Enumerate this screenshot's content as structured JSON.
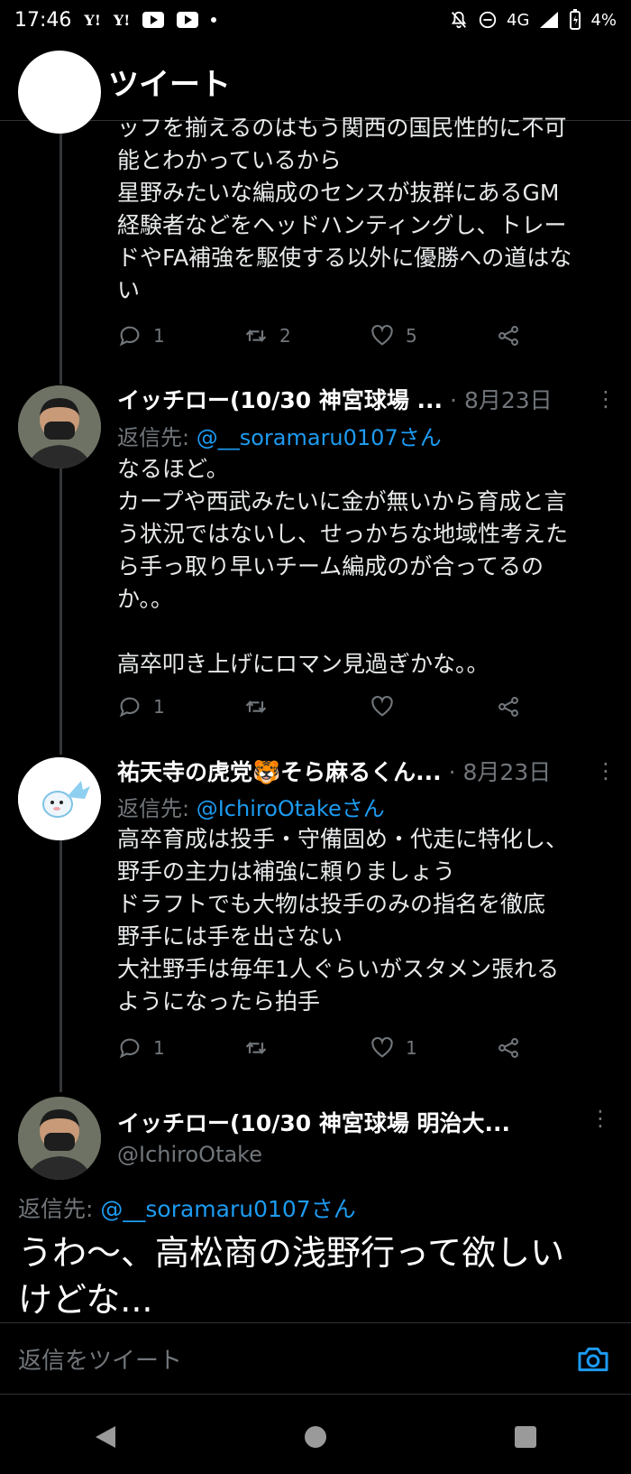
{
  "status_bar": {
    "time": "17:46",
    "left_icons": [
      "yahoo-icon",
      "yahoo-icon",
      "youtube-icon",
      "youtube-icon",
      "dot-icon"
    ],
    "yahoo_label": "Y!",
    "network": "4G",
    "battery": "4%"
  },
  "header": {
    "title": "ツイート"
  },
  "tweets": [
    {
      "text": "ッフを揃えるのはもう関西の国民性的に不可\n能とわかっているから\n星野みたいな編成のセンスが抜群にあるGM\n経験者などをヘッドハンティングし、トレー\nドやFA補強を駆使する以外に優勝への道はな\nい",
      "reply_count": "1",
      "retweet_count": "2",
      "like_count": "5"
    },
    {
      "name": "イッチロー(10/30 神宮球場 ...",
      "date": "· 8月23日",
      "reply_prefix": "返信先: ",
      "reply_handle": "@__soramaru0107さん",
      "text": "なるほど。\nカープや西武みたいに金が無いから育成と言\nう状況ではないし、せっかちな地域性考えた\nら手っ取り早いチーム編成のが合ってるの\nか。。\n\n高卒叩き上げにロマン見過ぎかな。。",
      "reply_count": "1",
      "retweet_count": "",
      "like_count": ""
    },
    {
      "name": "祐天寺の虎党🐯そら麻るくん...",
      "date": "· 8月23日",
      "reply_prefix": "返信先: ",
      "reply_handle": "@IchiroOtakeさん",
      "text": "高卒育成は投手・守備固め・代走に特化し、\n野手の主力は補強に頼りましょう\nドラフトでも大物は投手のみの指名を徹底\n野手には手を出さない\n大社野手は毎年1人ぐらいがスタメン張れる\nようになったら拍手",
      "reply_count": "1",
      "retweet_count": "",
      "like_count": "1"
    }
  ],
  "main_tweet": {
    "name": "イッチロー(10/30 神宮球場 明治大...",
    "handle": "@IchiroOtake",
    "reply_prefix": "返信先: ",
    "reply_handle": "@__soramaru0107さん",
    "text": "うわ〜、高松商の浅野行って欲しい\nけどな..."
  },
  "reply_bar": {
    "placeholder": "返信をツイート"
  },
  "colors": {
    "background": "#000000",
    "accent": "#1d9bf0",
    "muted": "#71767b",
    "text": "#e7e9ea"
  }
}
